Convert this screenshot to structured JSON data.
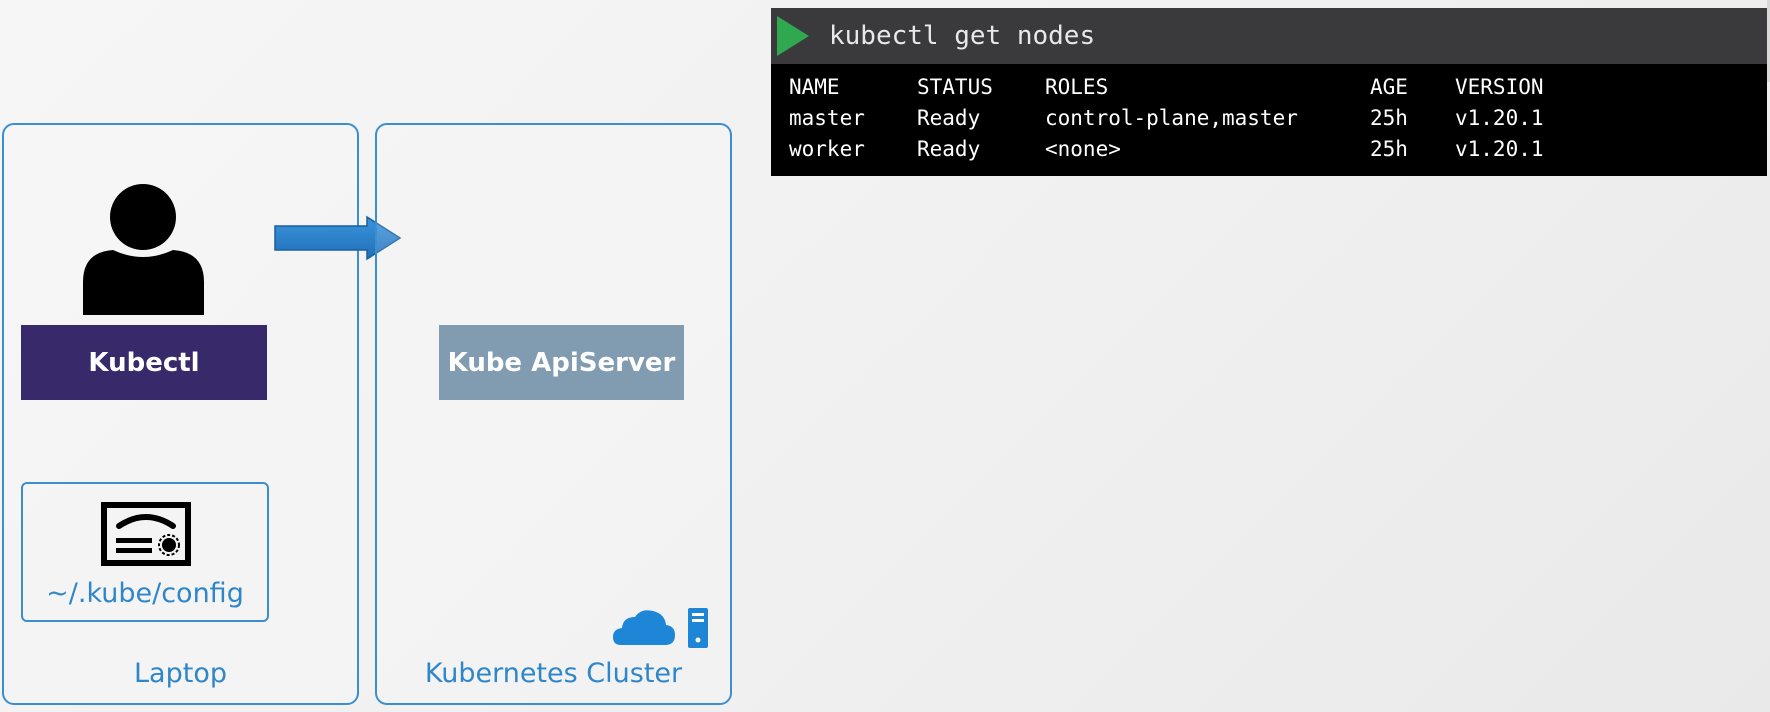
{
  "terminal": {
    "command": "kubectl get nodes",
    "headers": {
      "name": "NAME",
      "status": "STATUS",
      "roles": "ROLES",
      "age": "AGE",
      "version": "VERSION"
    },
    "rows": [
      {
        "name": "master",
        "status": "Ready",
        "roles": "control-plane,master",
        "age": "25h",
        "version": "v1.20.1"
      },
      {
        "name": "worker",
        "status": "Ready",
        "roles": "<none>",
        "age": "25h",
        "version": "v1.20.1"
      }
    ]
  },
  "laptop": {
    "caption": "Laptop",
    "kubectl_label": "Kubectl",
    "config_label": "~/.kube/config",
    "icons": [
      "person-icon",
      "certificate-icon"
    ]
  },
  "cluster": {
    "caption": "Kubernetes Cluster",
    "apiserver_label": "Kube ApiServer",
    "icons": [
      "cloud-icon",
      "server-icon"
    ]
  },
  "colors": {
    "panel_border": "#3b8fd0",
    "kubectl_bg": "#38296b",
    "apiserver_bg": "#819cb1",
    "arrow": "#2f7fc8",
    "play": "#2fa84f",
    "terminal_header": "#3a393b",
    "terminal_body": "#000000"
  }
}
